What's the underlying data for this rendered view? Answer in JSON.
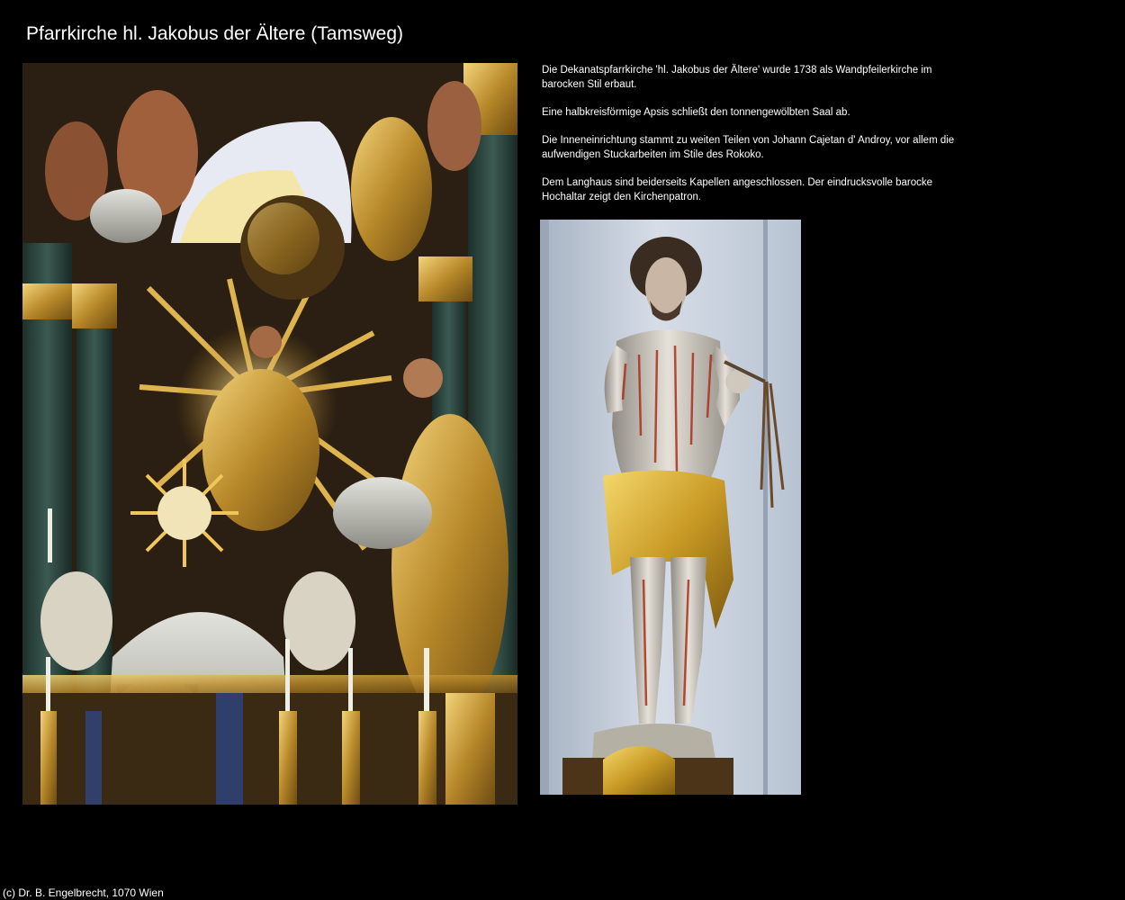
{
  "page": {
    "title": "Pfarrkirche hl. Jakobus der Ältere (Tamsweg)"
  },
  "description": {
    "paragraphs": [
      "Die Dekanatspfarrkirche 'hl. Jakobus der Ältere' wurde 1738 als Wandpfeilerkirche im barocken Stil erbaut.",
      "Eine halbkreisförmige Apsis schließt den tonnengewölbten Saal ab.",
      "Die Inneneinrichtung stammt zu weiten Teilen von Johann Cajetan d' Androy, vor allem die aufwendigen Stuckarbeiten im Stile des Rokoko.",
      "Dem Langhaus sind beiderseits Kapellen angeschlossen. Der eindrucksvolle barocke Hochaltar zeigt den Kirchenpatron."
    ]
  },
  "footer": {
    "copyright": "(c) Dr. B. Engelbrecht, 1070 Wien"
  },
  "colors": {
    "background": "#000000",
    "text": "#ffffff",
    "gold": "#c9a23a",
    "marble": "#2f4a40",
    "statue_wall": "#c8d2de"
  },
  "images": {
    "altar_photo": "baroque-high-altar-photo",
    "statue_photo": "christ-statue-photo"
  }
}
